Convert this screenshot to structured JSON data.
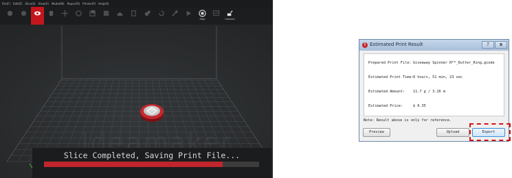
{
  "menu": [
    "File(F)",
    "Edit(E)",
    "Slice(S)",
    "View(V)",
    "Model(M)",
    "Repair(R)",
    "Printer(P)",
    "Help(H)"
  ],
  "toolbar": {
    "tools": [
      {
        "name": "open-icon",
        "label": "",
        "active": false
      },
      {
        "name": "cloud-icon",
        "label": "",
        "active": false
      },
      {
        "name": "eye-icon",
        "label": "",
        "active": true
      },
      {
        "name": "hand-icon",
        "label": "",
        "active": false
      },
      {
        "name": "move-icon",
        "label": "",
        "active": false
      },
      {
        "name": "rotate-icon",
        "label": "",
        "active": false
      },
      {
        "name": "scale-icon",
        "label": "",
        "active": false
      },
      {
        "name": "support-icon",
        "label": "",
        "active": false
      },
      {
        "name": "layer-icon",
        "label": "",
        "active": false
      },
      {
        "name": "cut-icon",
        "label": "",
        "active": false
      },
      {
        "name": "paint-icon",
        "label": "",
        "active": false
      },
      {
        "name": "undo-icon",
        "label": "",
        "active": false
      },
      {
        "name": "wrench-icon",
        "label": "",
        "active": false
      },
      {
        "name": "play-icon",
        "label": "",
        "active": false
      },
      {
        "name": "stop-icon",
        "label": "Stop",
        "active": false
      },
      {
        "name": "monitor-icon",
        "label": "",
        "active": false
      },
      {
        "name": "connect-icon",
        "label": "Connect",
        "active": false
      }
    ],
    "accent_color": "#c4161c"
  },
  "viewport": {
    "watermark": "Ideamaker"
  },
  "progress": {
    "text": "Slice Completed, Saving Print File...",
    "fraction": 0.83,
    "color": "#c0252d"
  },
  "dialog": {
    "title": "Estimated Print Result",
    "help_label": "?",
    "close_label": "x",
    "rows": [
      {
        "label": "Prepared Print File:",
        "value": "Giveaway Spinner R**_Dutter_Ring.gcode"
      },
      {
        "label": "Estimated Print Time:",
        "value": "0 hours, 51 min, 23 sec"
      },
      {
        "label": "Estimated Amount:",
        "value": "11.7 g / 3.26 m"
      },
      {
        "label": "Estimated Price:",
        "value": "$ 0.35"
      }
    ],
    "note": "Note: Result above is only for reference.",
    "buttons": {
      "preview": "Preview",
      "upload": "Upload",
      "export": "Export"
    }
  }
}
